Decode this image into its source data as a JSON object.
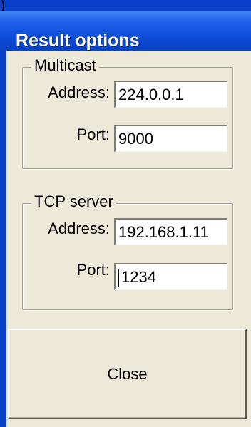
{
  "window": {
    "title": "Result options",
    "corner_glyph": ")"
  },
  "multicast": {
    "legend": "Multicast",
    "address_label": "Address:",
    "address_value": "224.0.0.1",
    "port_label": "Port:",
    "port_value": "9000"
  },
  "tcp_server": {
    "legend": "TCP server",
    "address_label": "Address:",
    "address_value": "192.168.1.11",
    "port_label": "Port:",
    "port_value": "1234"
  },
  "buttons": {
    "close_label": "Close"
  },
  "colors": {
    "titlebar": "#0b4bd6",
    "dialog_face": "#ece9d8",
    "field_background": "#ffffff"
  }
}
